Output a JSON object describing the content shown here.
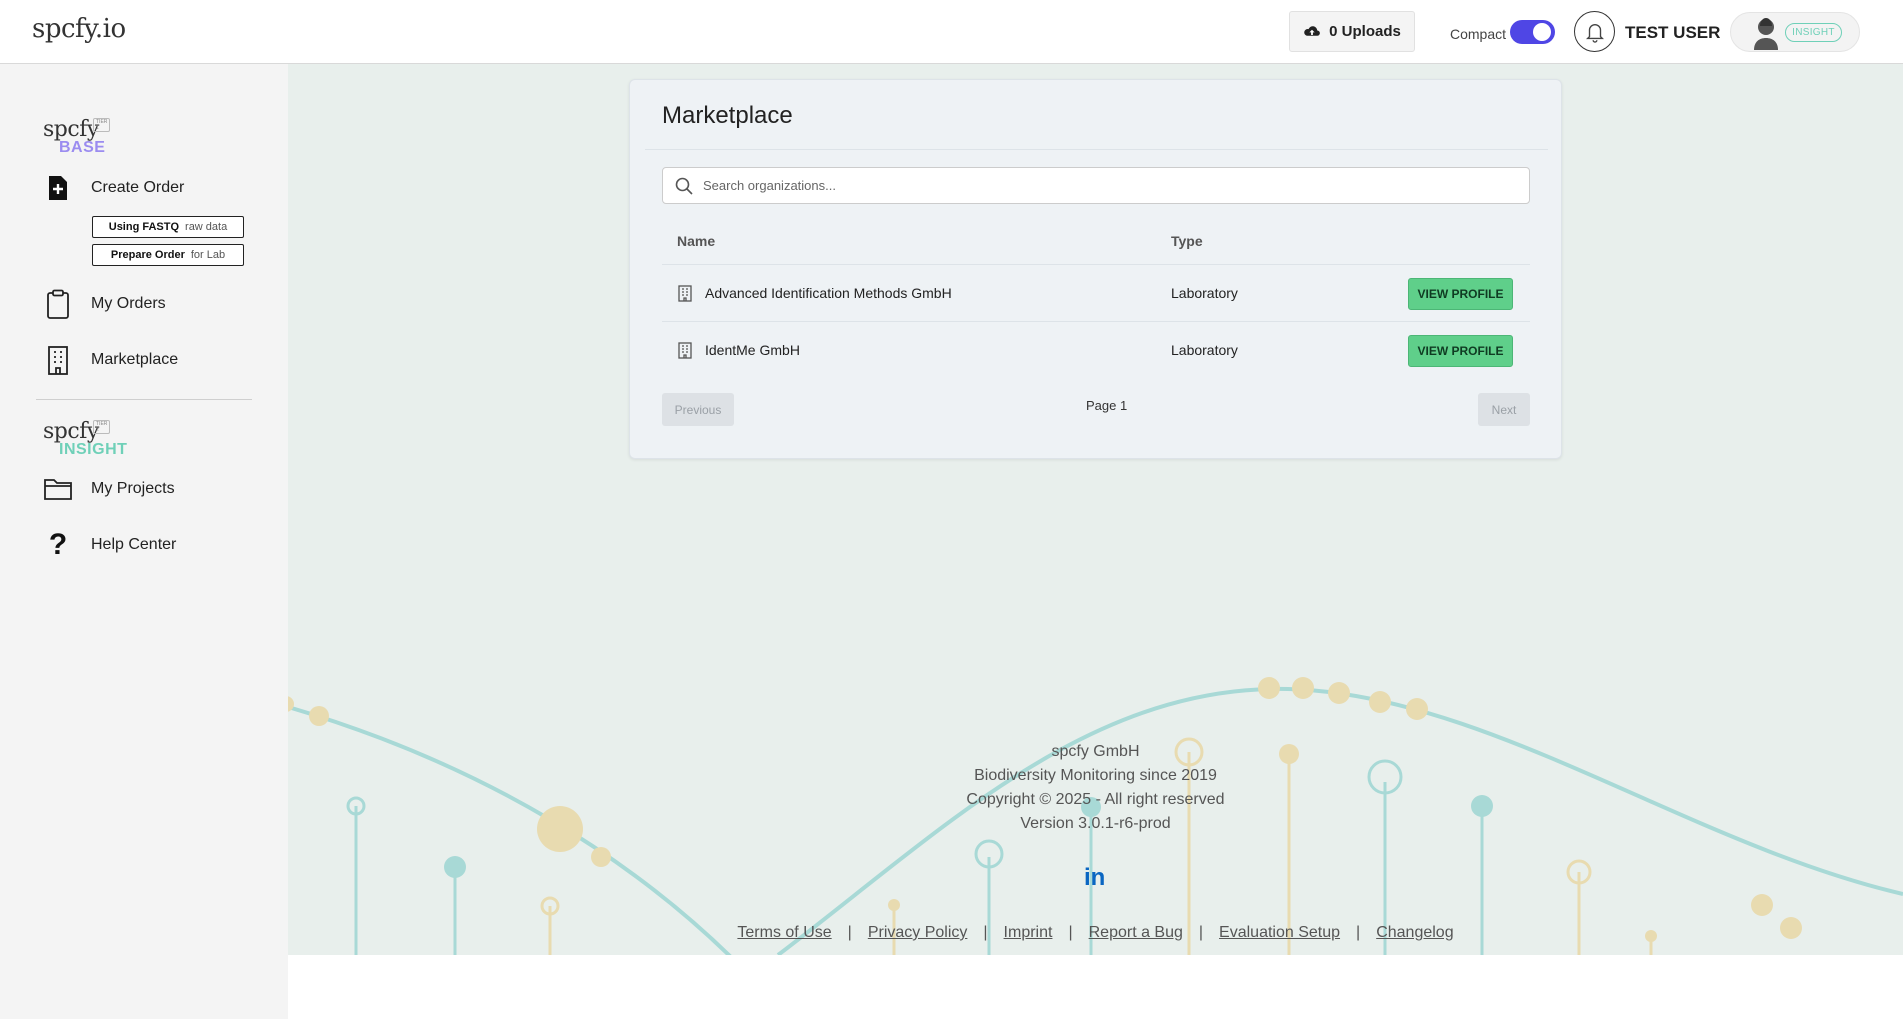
{
  "topbar": {
    "logo": "spcfy.io",
    "uploads_label": "0 Uploads",
    "compact_label": "Compact",
    "compact_on": true,
    "username": "TEST USER",
    "profile_badge": "INSIGHT"
  },
  "sidebar": {
    "base_brand": {
      "word": "spcfy",
      "tier": "TIER 1",
      "sub": "BASE",
      "color": "#9b8cf0"
    },
    "create_order": "Create Order",
    "using_fastq": {
      "bold": "Using FASTQ",
      "light": "raw data"
    },
    "prepare_order": {
      "bold": "Prepare Order",
      "light": "for Lab"
    },
    "my_orders": "My Orders",
    "marketplace": "Marketplace",
    "insight_brand": {
      "word": "spcfy",
      "tier": "TIER 2",
      "sub": "INSIGHT",
      "color": "#6fd0b8"
    },
    "my_projects": "My Projects",
    "help_center": "Help Center"
  },
  "marketplace": {
    "title": "Marketplace",
    "search_placeholder": "Search organizations...",
    "columns": {
      "name": "Name",
      "type": "Type"
    },
    "rows": [
      {
        "name": "Advanced Identification Methods GmbH",
        "type": "Laboratory",
        "action": "VIEW PROFILE"
      },
      {
        "name": "IdentMe GmbH",
        "type": "Laboratory",
        "action": "VIEW PROFILE"
      }
    ],
    "pagination": {
      "previous": "Previous",
      "page": "Page 1",
      "next": "Next"
    }
  },
  "footer": {
    "company": "spcfy GmbH",
    "tagline": "Biodiversity Monitoring since 2019",
    "copyright": "Copyright © 2025 - All right reserved",
    "version": "Version 3.0.1-r6-prod",
    "linkedin": "in",
    "links": [
      "Terms of Use",
      "Privacy Policy",
      "Imprint",
      "Report a Bug",
      "Evaluation Setup",
      "Changelog"
    ],
    "separator": "|"
  }
}
